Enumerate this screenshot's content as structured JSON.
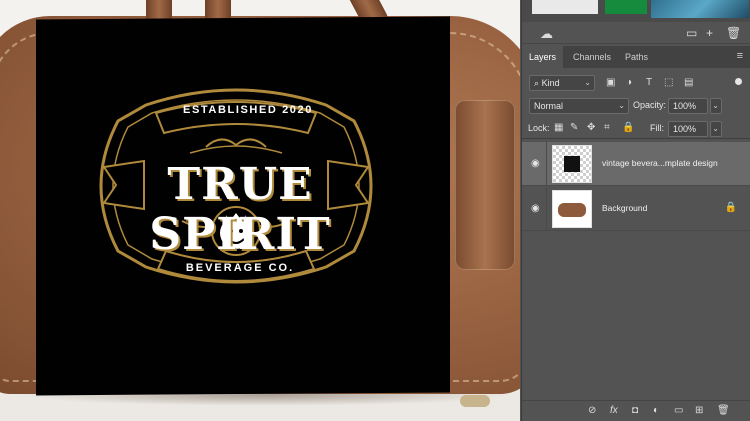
{
  "canvas": {
    "badge": {
      "established": "ESTABLISHED 2020",
      "title": "TRUE SPIRIT",
      "subtitle": "BEVERAGE CO."
    }
  },
  "panel": {
    "topbar_icons": [
      "folder-icon",
      "new-layer-icon",
      "delete-icon"
    ],
    "tabs": [
      "Layers",
      "Channels",
      "Paths"
    ],
    "active_tab": "Layers",
    "filter": {
      "kind_label": "Kind",
      "kind_glyph": "⌕"
    },
    "blend_mode": "Normal",
    "opacity_label": "Opacity:",
    "opacity_value": "100%",
    "lock_label": "Lock:",
    "fill_label": "Fill:",
    "fill_value": "100%",
    "layers": [
      {
        "name": "vintage bevera...mplate design",
        "selected": true,
        "locked": false
      },
      {
        "name": "Background",
        "selected": false,
        "locked": true
      }
    ]
  },
  "colors": {
    "panel_bg": "#535353",
    "selected_layer_bg": "#6a6a6a",
    "badge_gold": "#b08a3c",
    "leather": "#9a6442"
  }
}
